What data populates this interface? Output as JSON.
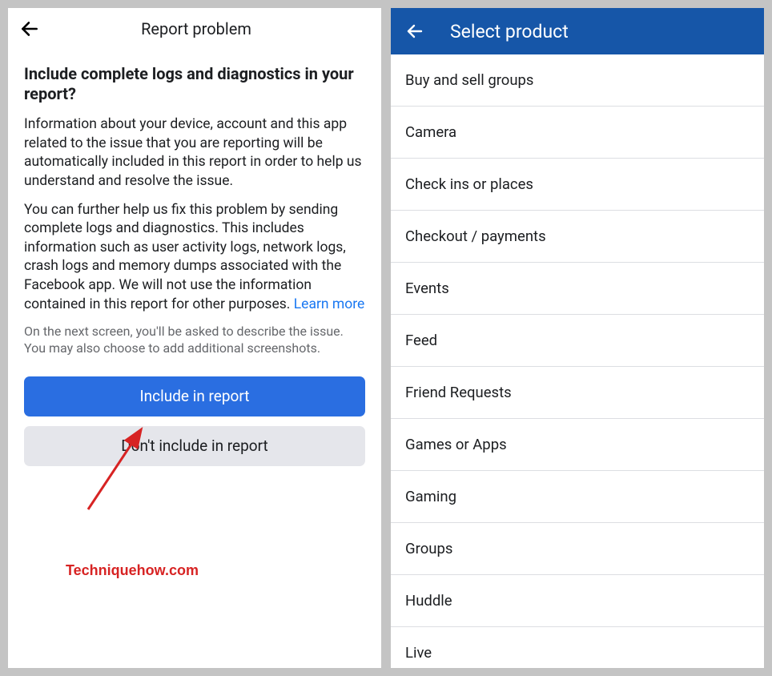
{
  "left": {
    "header_title": "Report problem",
    "heading": "Include complete logs and diagnostics in your report?",
    "para1": "Information about your device, account and this app related to the issue that you are reporting will be automatically included in this report in order to help us understand and resolve the issue.",
    "para2_part1": "You can further help us fix this problem by sending complete logs and diagnostics. This includes information such as user activity logs, network logs, crash logs and memory dumps associated with the Facebook app. We will not use the information contained in this report for other purposes. ",
    "learn_more": "Learn more",
    "muted": "On the next screen, you'll be asked to describe the issue. You may also choose to add additional screenshots.",
    "btn_include": "Include in report",
    "btn_dont": "Don't include in report",
    "watermark": "Techniquehow.com"
  },
  "right": {
    "header_title": "Select product",
    "items": [
      "Buy and sell groups",
      "Camera",
      "Check ins or places",
      "Checkout / payments",
      "Events",
      "Feed",
      "Friend Requests",
      "Games or Apps",
      "Gaming",
      "Groups",
      "Huddle",
      "Live"
    ]
  }
}
